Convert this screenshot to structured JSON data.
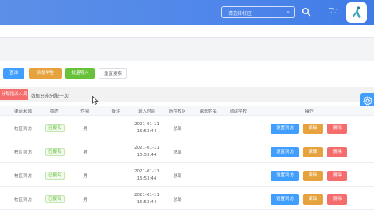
{
  "header": {
    "campus_placeholder": "请选择校区",
    "icons": [
      "chevron-down-icon",
      "search-icon",
      "font-size-icon",
      "avatar"
    ]
  },
  "toolbar": {
    "query_label": "查询",
    "add_label": "添加学生",
    "import_label": "批量导入",
    "reset_label": "重置搜索"
  },
  "assign": {
    "button_label": "分配指派人员",
    "note": "数据只能分配一次"
  },
  "table": {
    "columns": [
      "渠道来源",
      "状态",
      "性别",
      "备注",
      "录入时间",
      "所在校区",
      "家长姓名",
      "就读学校",
      "操作"
    ],
    "rows": [
      {
        "source": "校区到访",
        "status": "已报名",
        "gender": "男",
        "date": "2021-01-11",
        "time": "15:53:44",
        "campus": "总部"
      },
      {
        "source": "校区到访",
        "status": "已报名",
        "gender": "男",
        "date": "2021-01-11",
        "time": "15:53:44",
        "campus": "总部"
      },
      {
        "source": "校区到访",
        "status": "已报名",
        "gender": "男",
        "date": "2021-01-11",
        "time": "15:53:44",
        "campus": "总部"
      },
      {
        "source": "校区到访",
        "status": "已报名",
        "gender": "男",
        "date": "2021-01-11",
        "time": "15:53:44",
        "campus": "总部"
      }
    ],
    "actions": {
      "visit": "设置到访",
      "edit": "编辑",
      "delete": "删除"
    }
  },
  "colors": {
    "header_bg": "#4f86ea",
    "primary": "#409eff",
    "warning": "#e6a23c",
    "success": "#67c23a",
    "danger": "#f56c6c"
  }
}
